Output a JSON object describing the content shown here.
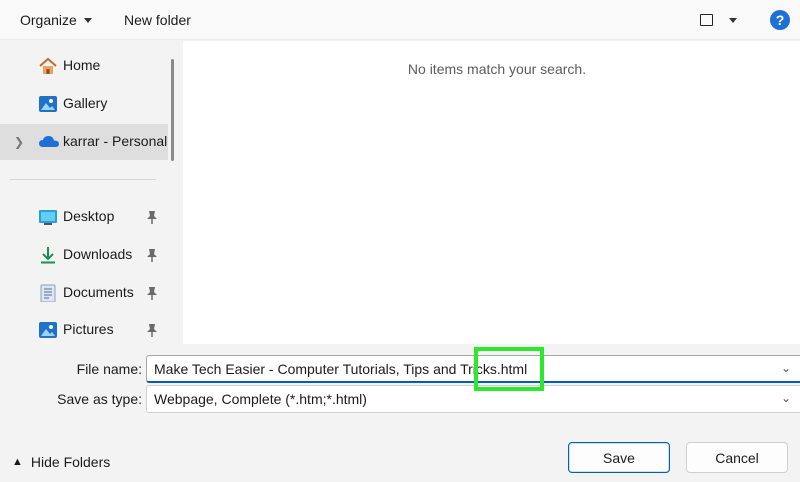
{
  "toolbar": {
    "organize_label": "Organize",
    "new_folder_label": "New folder",
    "view_icon": "view-layout-icon",
    "help_label": "?"
  },
  "sidebar": {
    "quick_items": [
      {
        "label": "Home",
        "icon": "home-icon"
      },
      {
        "label": "Gallery",
        "icon": "gallery-icon"
      },
      {
        "label": "karrar - Personal",
        "icon": "onedrive-cloud-icon",
        "selected": true
      }
    ],
    "pinned_items": [
      {
        "label": "Desktop",
        "icon": "desktop-icon"
      },
      {
        "label": "Downloads",
        "icon": "download-icon"
      },
      {
        "label": "Documents",
        "icon": "documents-icon"
      },
      {
        "label": "Pictures",
        "icon": "pictures-icon"
      }
    ]
  },
  "content": {
    "empty_message": "No items match your search."
  },
  "form": {
    "file_name_label": "File name:",
    "file_name_value": "Make Tech Easier - Computer Tutorials, Tips and Tricks.html",
    "save_type_label": "Save as type:",
    "save_type_value": "Webpage, Complete (*.htm;*.html)"
  },
  "footer": {
    "hide_folders_label": "Hide Folders",
    "save_label": "Save",
    "cancel_label": "Cancel"
  },
  "colors": {
    "accent": "#005fb8",
    "highlight": "#2ee82e",
    "help_blue": "#1e6fd6"
  }
}
